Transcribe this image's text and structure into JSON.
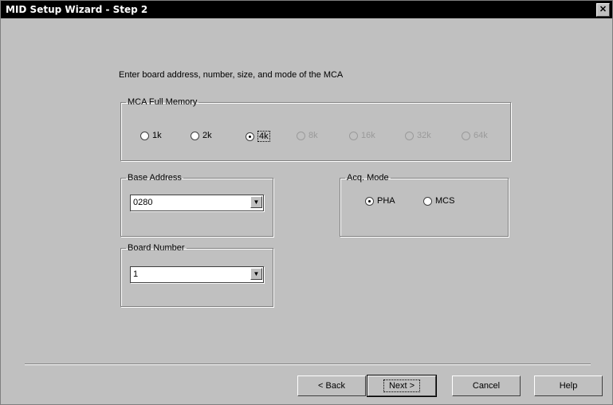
{
  "window": {
    "title": "MID Setup Wizard - Step 2",
    "close_label": "✕"
  },
  "instruction": "Enter board address, number, size, and mode of the MCA",
  "memory_group": {
    "legend": "MCA Full Memory",
    "options": [
      {
        "label": "1k",
        "checked": false,
        "disabled": false
      },
      {
        "label": "2k",
        "checked": false,
        "disabled": false
      },
      {
        "label": "4k",
        "checked": true,
        "disabled": false
      },
      {
        "label": "8k",
        "checked": false,
        "disabled": true
      },
      {
        "label": "16k",
        "checked": false,
        "disabled": true
      },
      {
        "label": "32k",
        "checked": false,
        "disabled": true
      },
      {
        "label": "64k",
        "checked": false,
        "disabled": true
      }
    ]
  },
  "base_address": {
    "legend": "Base Address",
    "value": "0280",
    "arrow": "▼"
  },
  "acq_mode": {
    "legend": "Acq. Mode",
    "options": [
      {
        "label": "PHA",
        "checked": true
      },
      {
        "label": "MCS",
        "checked": false
      }
    ]
  },
  "board_number": {
    "legend": "Board Number",
    "value": "1",
    "arrow": "▼"
  },
  "buttons": {
    "back": "< Back",
    "next": "Next >",
    "cancel": "Cancel",
    "help": "Help"
  }
}
